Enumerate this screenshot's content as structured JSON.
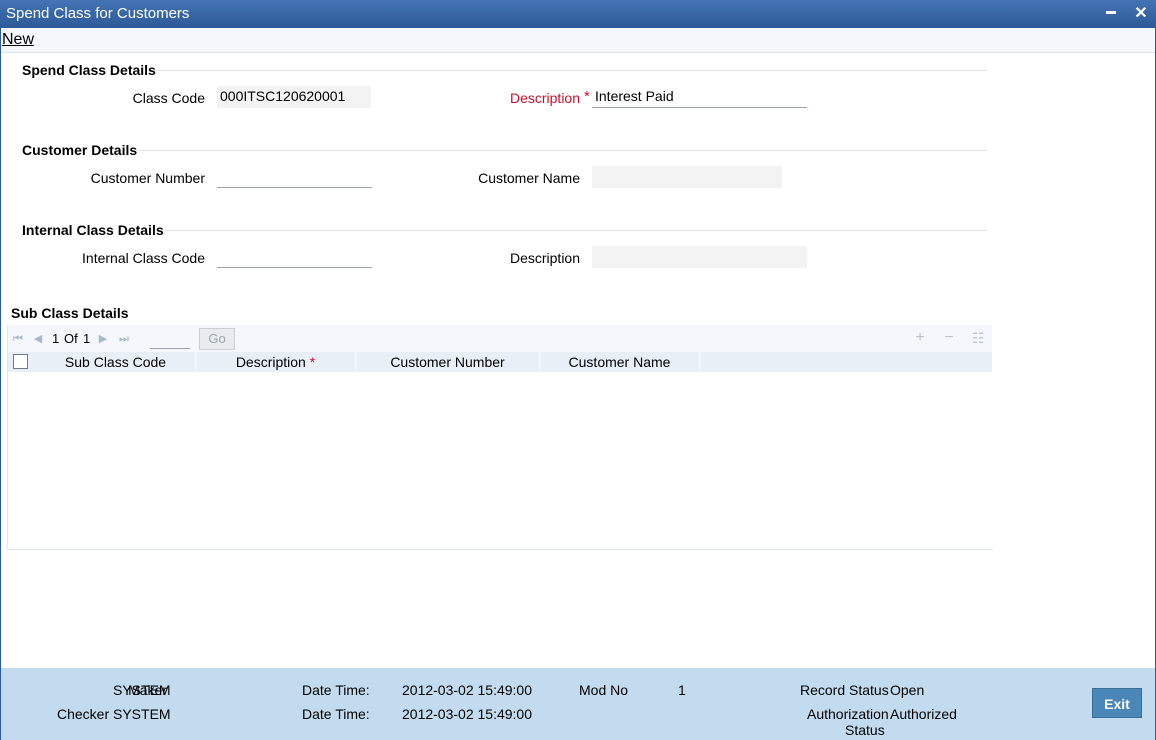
{
  "window": {
    "title": "Spend Class for Customers",
    "minimize_icon": "minimize-icon",
    "close_icon": "close-icon"
  },
  "toolbar": {
    "new_label": "New"
  },
  "spend_class": {
    "section_title": "Spend Class Details",
    "class_code_label": "Class Code",
    "class_code_value": "000ITSC120620001",
    "description_label": "Description",
    "required_mark": "*",
    "description_value": "Interest Paid"
  },
  "customer": {
    "section_title": "Customer Details",
    "customer_number_label": "Customer Number",
    "customer_number_value": "",
    "customer_name_label": "Customer Name",
    "customer_name_value": ""
  },
  "internal_class": {
    "section_title": "Internal Class Details",
    "internal_class_code_label": "Internal Class Code",
    "internal_class_code_value": "",
    "description_label": "Description",
    "description_value": ""
  },
  "sub_class": {
    "section_title": "Sub Class Details",
    "pager": {
      "current": "1",
      "of_label": "Of",
      "total": "1",
      "go_label": "Go"
    },
    "columns": [
      {
        "label": "Sub Class Code",
        "required": ""
      },
      {
        "label": "Description",
        "required": "*"
      },
      {
        "label": "Customer Number",
        "required": ""
      },
      {
        "label": "Customer Name",
        "required": ""
      }
    ],
    "rows": []
  },
  "footer": {
    "maker_label": "Maker",
    "maker_value": "SYSTEM",
    "checker_label": "Checker",
    "checker_value": "SYSTEM",
    "date_time_label": "Date Time:",
    "maker_date_time": "2012-03-02 15:49:00",
    "checker_date_time": "2012-03-02 15:49:00",
    "mod_no_label": "Mod No",
    "mod_no_value": "1",
    "record_status_label": "Record Status",
    "record_status_value": "Open",
    "auth_status_label_1": "Authorization",
    "auth_status_label_2": "Status",
    "auth_status_value": "Authorized",
    "exit_label": "Exit"
  }
}
